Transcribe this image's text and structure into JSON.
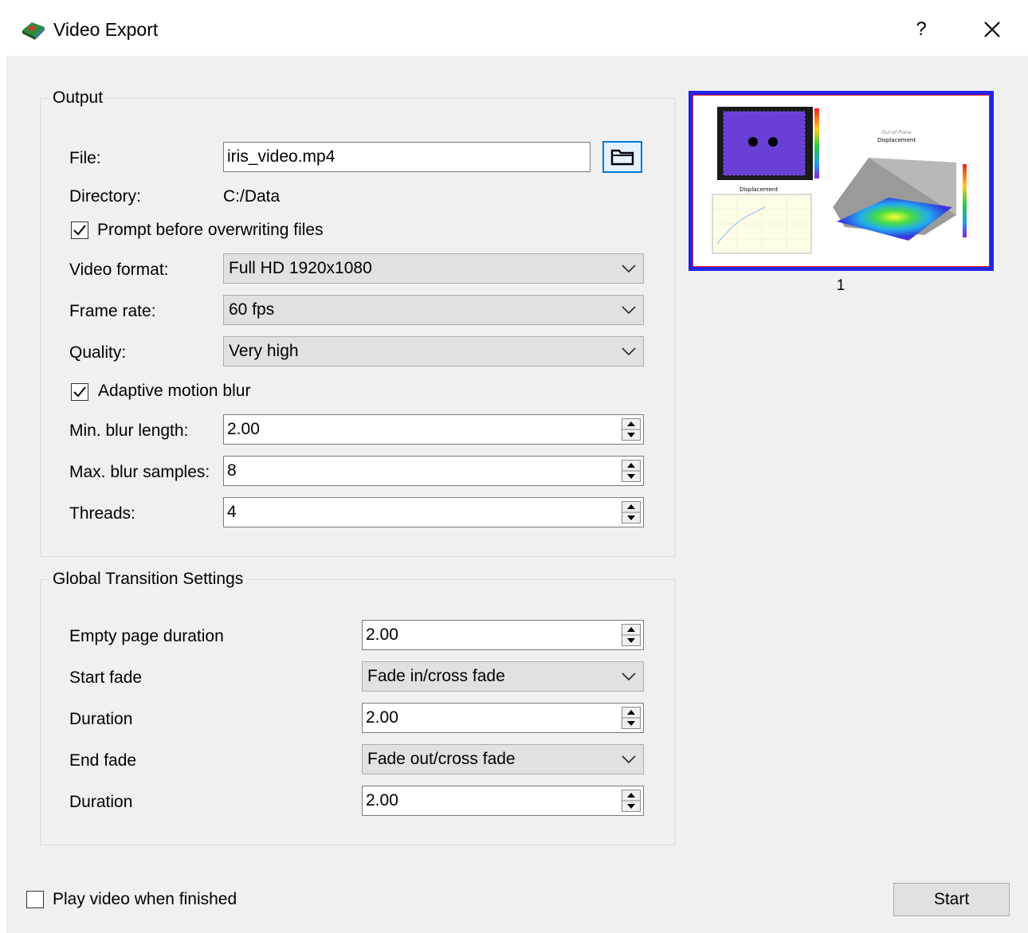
{
  "window": {
    "title": "Video Export",
    "help_label": "?",
    "close_label": "✕",
    "app_icon": "app-logo-icon"
  },
  "output": {
    "group_title": "Output",
    "file_label": "File:",
    "file_value": "iris_video.mp4",
    "browse_icon": "folder-icon",
    "directory_label": "Directory:",
    "directory_value": "C:/Data",
    "prompt_overwrite_label": "Prompt before overwriting files",
    "prompt_overwrite_checked": true,
    "video_format_label": "Video format:",
    "video_format_value": "Full HD 1920x1080",
    "frame_rate_label": "Frame rate:",
    "frame_rate_value": "60 fps",
    "quality_label": "Quality:",
    "quality_value": "Very high",
    "adaptive_blur_label": "Adaptive motion blur",
    "adaptive_blur_checked": true,
    "min_blur_label": "Min. blur length:",
    "min_blur_value": "2.00",
    "max_blur_label": "Max. blur samples:",
    "max_blur_value": "8",
    "threads_label": "Threads:",
    "threads_value": "4"
  },
  "transitions": {
    "group_title": "Global Transition Settings",
    "empty_page_label": "Empty page duration",
    "empty_page_value": "2.00",
    "start_fade_label": "Start fade",
    "start_fade_value": "Fade in/cross fade",
    "start_duration_label": "Duration",
    "start_duration_value": "2.00",
    "end_fade_label": "End fade",
    "end_fade_value": "Fade out/cross fade",
    "end_duration_label": "Duration",
    "end_duration_value": "2.00"
  },
  "preview": {
    "page_number": "1",
    "selection_colors": {
      "outer": "#2323e6",
      "inner": "#e61b1b"
    },
    "thumb_heading_small": "Out-of-Plane",
    "thumb_heading": "Displacement",
    "thumb_chart_title": "Displacement"
  },
  "footer": {
    "play_when_finished_label": "Play video when finished",
    "play_when_finished_checked": false,
    "start_label": "Start"
  }
}
